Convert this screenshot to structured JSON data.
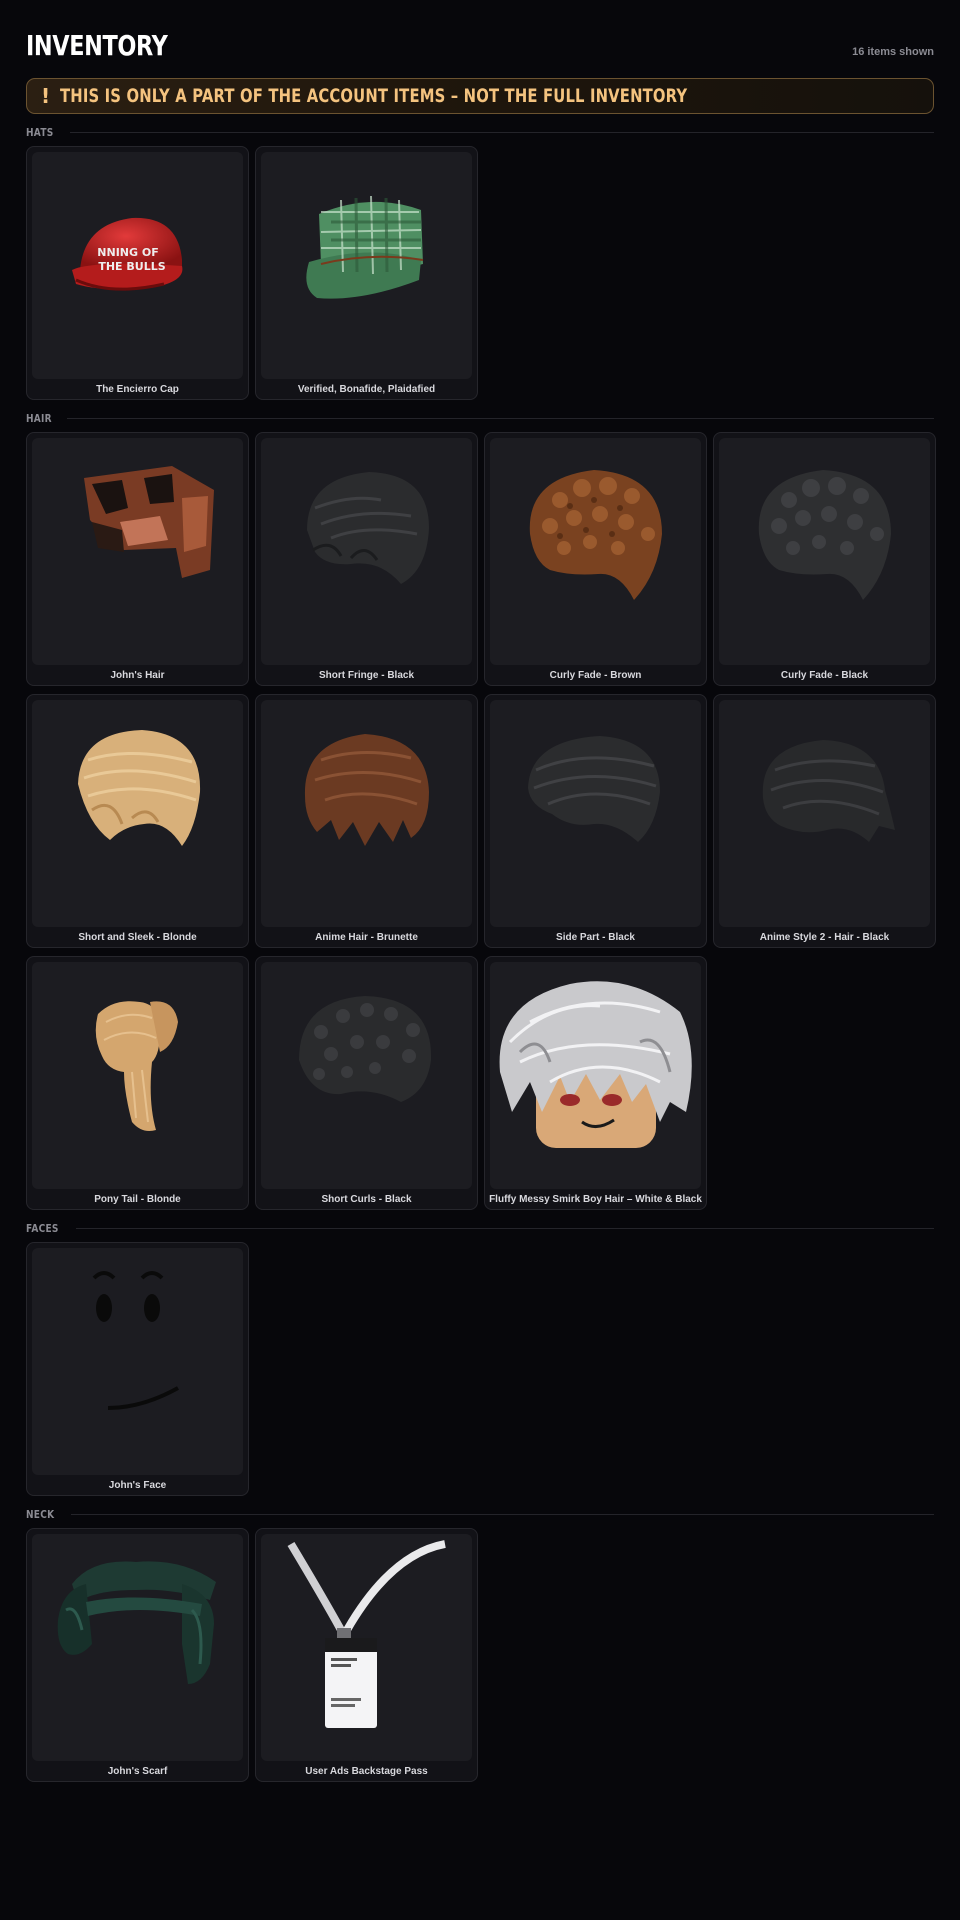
{
  "header": {
    "title": "INVENTORY",
    "count": "16 items shown"
  },
  "banner": {
    "icon": "!",
    "text": "THIS IS ONLY A PART OF THE ACCOUNT ITEMS – NOT THE FULL INVENTORY",
    "accent": "#f4c37f"
  },
  "sections": {
    "hats": {
      "label": "HATS",
      "items": [
        {
          "name": "The Encierro Cap",
          "icon": "red-cap",
          "cap_text_1": "NNING OF",
          "cap_text_2": "THE BULLS"
        },
        {
          "name": "Verified, Bonafide, Plaidafied",
          "icon": "green-plaid-cap"
        }
      ]
    },
    "hair": {
      "label": "HAIR",
      "items": [
        {
          "name": "John's Hair",
          "icon": "brown-blocky-hair"
        },
        {
          "name": "Short Fringe - Black",
          "icon": "black-fringe-hair"
        },
        {
          "name": "Curly Fade - Brown",
          "icon": "brown-curly-hair"
        },
        {
          "name": "Curly Fade - Black",
          "icon": "black-curly-hair"
        },
        {
          "name": "Short and Sleek - Blonde",
          "icon": "blonde-sleek-hair"
        },
        {
          "name": "Anime Hair - Brunette",
          "icon": "brunette-anime-hair"
        },
        {
          "name": "Side Part - Black",
          "icon": "black-side-part-hair"
        },
        {
          "name": "Anime Style 2 - Hair - Black",
          "icon": "black-anime-hair"
        },
        {
          "name": "Pony Tail - Blonde",
          "icon": "blonde-ponytail-hair"
        },
        {
          "name": "Short Curls - Black",
          "icon": "black-short-curls-hair"
        },
        {
          "name": "Fluffy Messy Smirk Boy Hair – White & Black",
          "icon": "white-fluffy-hair-head"
        }
      ]
    },
    "faces": {
      "label": "FACES",
      "items": [
        {
          "name": "John's Face",
          "icon": "smirk-face"
        }
      ]
    },
    "neck": {
      "label": "NECK",
      "items": [
        {
          "name": "John's Scarf",
          "icon": "dark-green-scarf"
        },
        {
          "name": "User Ads Backstage Pass",
          "icon": "lanyard-pass"
        }
      ]
    }
  }
}
